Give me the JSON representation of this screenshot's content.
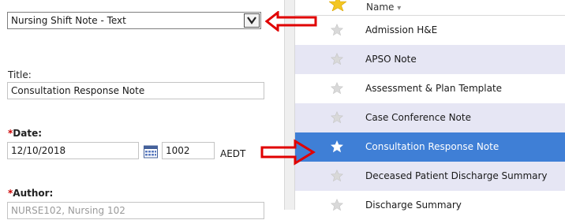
{
  "template": {
    "selected": "Nursing Shift Note - Text"
  },
  "title": {
    "label": "Title:",
    "value": "Consultation Response Note"
  },
  "date": {
    "required_mark": "*",
    "label": "Date:",
    "value": "12/10/2018",
    "time": "1002",
    "timezone": "AEDT"
  },
  "author": {
    "required_mark": "*",
    "label": "Author:",
    "value": "NURSE102, Nursing 102"
  },
  "list": {
    "column_header": "Name",
    "sort_indicator": "▾",
    "items": [
      {
        "label": "Admission H&E"
      },
      {
        "label": "APSO Note"
      },
      {
        "label": "Assessment & Plan Template"
      },
      {
        "label": "Case Conference Note"
      },
      {
        "label": "Consultation Response Note",
        "selected": true
      },
      {
        "label": "Deceased Patient Discharge Summary"
      },
      {
        "label": "Discharge Summary"
      }
    ]
  },
  "colors": {
    "selection": "#3f7fd6",
    "row_shade": "#e6e6f4",
    "annotation_arrow": "#e00000",
    "star_header": "#f3c623",
    "star_idle": "#d9d9d9"
  },
  "icons": {
    "header_star": "star-icon",
    "row_star": "star-outline-icon",
    "calendar": "calendar-icon",
    "dropdown": "chevron-down-icon"
  }
}
